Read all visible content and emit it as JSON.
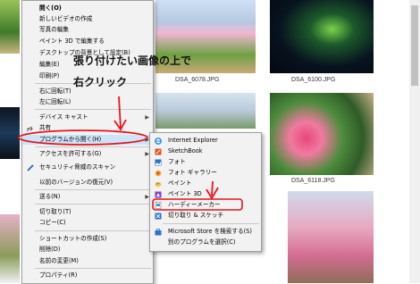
{
  "files": {
    "dsa6078": "DSA_6078.JPG",
    "dsa6100": "DSA_6100.JPG",
    "dsa6118": "DSA_6118.JPG"
  },
  "annotation": {
    "line1": "張り付けたい画像の上で",
    "line2": "右クリック"
  },
  "context_menu": {
    "open": "開く(O)",
    "new_video": "新しいビデオの作成",
    "edit_photo": "写真の編集",
    "paint3d_edit": "ペイント 3D で編集する",
    "desktop_bg": "デスクトップの背景として設定(B)",
    "edit": "編集(E)",
    "print": "印刷(P)",
    "rotate_right": "右に回転(T)",
    "rotate_left": "左に回転(L)",
    "cast": "デバイス キャスト",
    "share": "共有",
    "open_with": "プログラムから開く(H)",
    "give_access": "アクセスを許可する(G)",
    "scan": "セキュリティ脅威のスキャン",
    "restore": "以前のバージョンの復元(V)",
    "send_to": "送る(N)",
    "cut": "切り取り(T)",
    "copy": "コピー(C)",
    "shortcut": "ショートカットの作成(S)",
    "delete": "削除(D)",
    "rename": "名前の変更(M)",
    "properties": "プロパティ(R)"
  },
  "submenu": {
    "ie": "Internet Explorer",
    "sketchbook": "SketchBook",
    "photos": "フォト",
    "gallery": "フォト ギャラリー",
    "paint": "ペイント",
    "paint3d": "ペイント 3D",
    "hardy": "ハーディーメーカー",
    "snip": "切り取り & スケッチ",
    "store": "Microsoft Store を検索する(S)",
    "other": "別のプログラムを選択(C)"
  },
  "colors": {
    "annotation_red": "#e8141e",
    "menu_bg": "#f2f2f2"
  }
}
